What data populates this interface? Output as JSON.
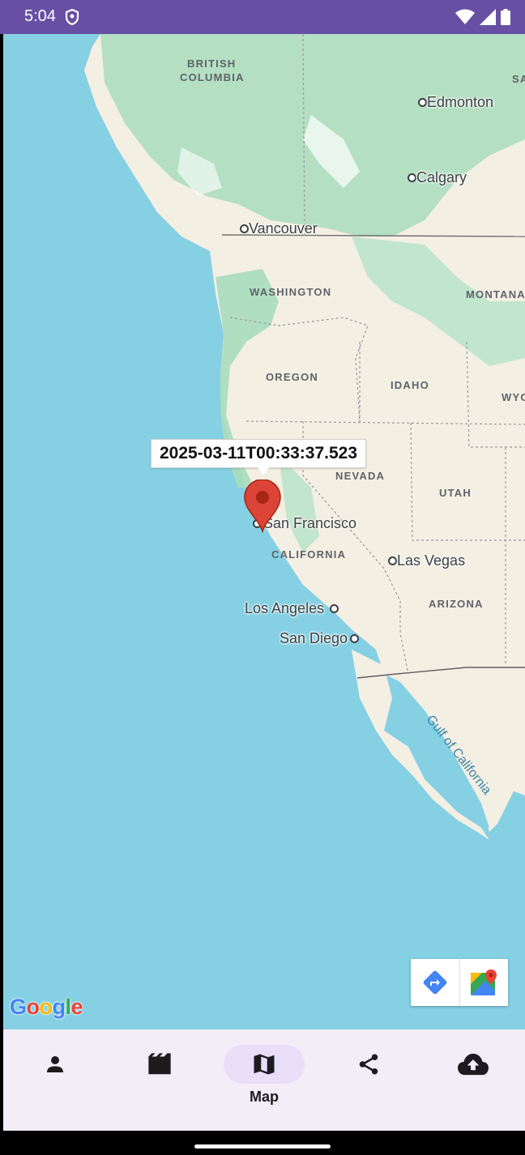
{
  "status_bar": {
    "time": "5:04",
    "icons": [
      "shield-icon",
      "wifi-icon",
      "signal-icon",
      "battery-icon"
    ]
  },
  "map": {
    "region_labels": [
      "BRITISH",
      "COLUMBIA",
      "WASHINGTON",
      "MONTANA",
      "OREGON",
      "IDAHO",
      "WYO",
      "NEVADA",
      "UTAH",
      "CALIFORNIA",
      "ARIZONA",
      "SA"
    ],
    "cities": [
      "Edmonton",
      "Calgary",
      "Vancouver",
      "San Francisco",
      "Las Vegas",
      "Los Angeles",
      "San Diego"
    ],
    "water": "Gulf of California",
    "marker_info": "2025-03-11T00:33:37.523",
    "google_logo": [
      "G",
      "o",
      "o",
      "g",
      "l",
      "e"
    ],
    "toolbar": [
      "directions-icon",
      "google-maps-icon"
    ]
  },
  "colors": {
    "status_bar": "#6750a4",
    "water": "#86d0e4",
    "land": "#f4efe3",
    "forest": "#a8dcbd",
    "marker": "#db4437",
    "nav_bg": "#f3edf7",
    "nav_active": "#e8def8"
  },
  "nav": {
    "items": [
      {
        "icon": "person-icon",
        "label": ""
      },
      {
        "icon": "movie-icon",
        "label": ""
      },
      {
        "icon": "map-icon",
        "label": "Map",
        "active": true
      },
      {
        "icon": "share-icon",
        "label": ""
      },
      {
        "icon": "cloud-upload-icon",
        "label": ""
      }
    ]
  }
}
